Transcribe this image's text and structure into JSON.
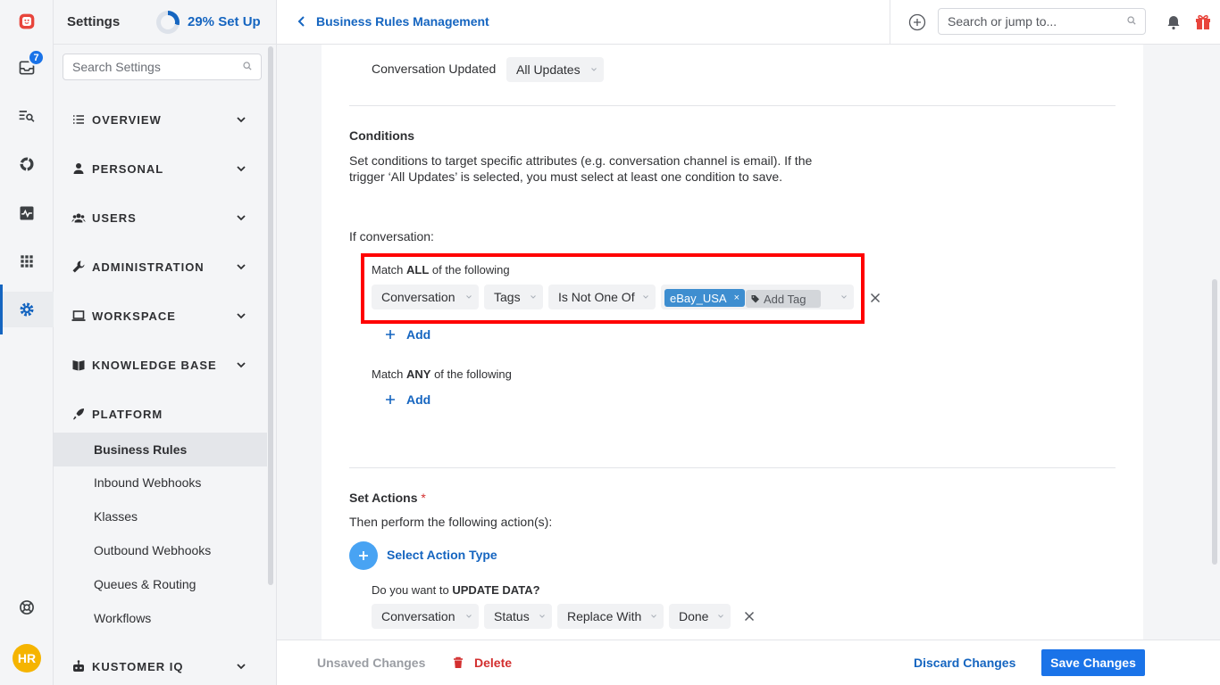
{
  "rail": {
    "inbox_badge": "7",
    "avatar_initials": "HR",
    "icons": [
      "app-logo-icon",
      "inbox-icon",
      "search-list-icon",
      "reporting-icon",
      "activity-icon",
      "apps-grid-icon",
      "settings-gear-icon",
      "help-icon"
    ]
  },
  "settings": {
    "title": "Settings",
    "setup_progress": 0.29,
    "setup_label": "29% Set Up",
    "search_placeholder": "Search Settings",
    "sections": [
      {
        "label": "OVERVIEW",
        "icon": "list-icon"
      },
      {
        "label": "PERSONAL",
        "icon": "person-icon"
      },
      {
        "label": "USERS",
        "icon": "users-icon"
      },
      {
        "label": "ADMINISTRATION",
        "icon": "wrench-icon"
      },
      {
        "label": "WORKSPACE",
        "icon": "laptop-icon"
      },
      {
        "label": "KNOWLEDGE BASE",
        "icon": "book-icon"
      },
      {
        "label": "PLATFORM",
        "icon": "rocket-icon"
      },
      {
        "label": "KUSTOMER IQ",
        "icon": "robot-icon"
      }
    ],
    "platform_items": [
      "Business Rules",
      "Inbound Webhooks",
      "Klasses",
      "Outbound Webhooks",
      "Queues & Routing",
      "Workflows"
    ],
    "active_item": "Business Rules"
  },
  "topbar": {
    "breadcrumb": "Business Rules Management",
    "search_placeholder": "Search or jump to..."
  },
  "trigger": {
    "label": "Conversation Updated",
    "value": "All Updates"
  },
  "conditions": {
    "heading": "Conditions",
    "description_line1": "Set conditions to target specific attributes (e.g. conversation channel is email). If the",
    "description_line2": "trigger ‘All Updates’ is selected, you must select at least one condition to save.",
    "if_label": "If conversation:",
    "match_all": {
      "prefix": "Match ",
      "keyword": "ALL",
      "suffix": " of the following"
    },
    "rule": {
      "object": "Conversation",
      "field": "Tags",
      "operator": "Is Not One Of",
      "tag": "eBay_USA",
      "tag_remove": "×",
      "add_tag_placeholder": "Add Tag"
    },
    "add_label": "Add",
    "match_any": {
      "prefix": "Match ",
      "keyword": "ANY",
      "suffix": " of the following"
    }
  },
  "actions": {
    "heading": "Set Actions",
    "required_mark": "*",
    "subheading": "Then perform the following action(s):",
    "select_action": "Select Action Type",
    "question_prefix": "Do you want to ",
    "question_keyword": "UPDATE DATA?",
    "row": {
      "object": "Conversation",
      "field": "Status",
      "operation": "Replace With",
      "value": "Done"
    }
  },
  "footer": {
    "unsaved": "Unsaved Changes",
    "delete": "Delete",
    "discard": "Discard Changes",
    "save": "Save Changes"
  },
  "colors": {
    "accent": "#1565c0",
    "primary_button": "#1a73e8",
    "highlight_box": "#ff0000",
    "delete": "#d32f2f",
    "tag_chip": "#3e8ed0"
  }
}
